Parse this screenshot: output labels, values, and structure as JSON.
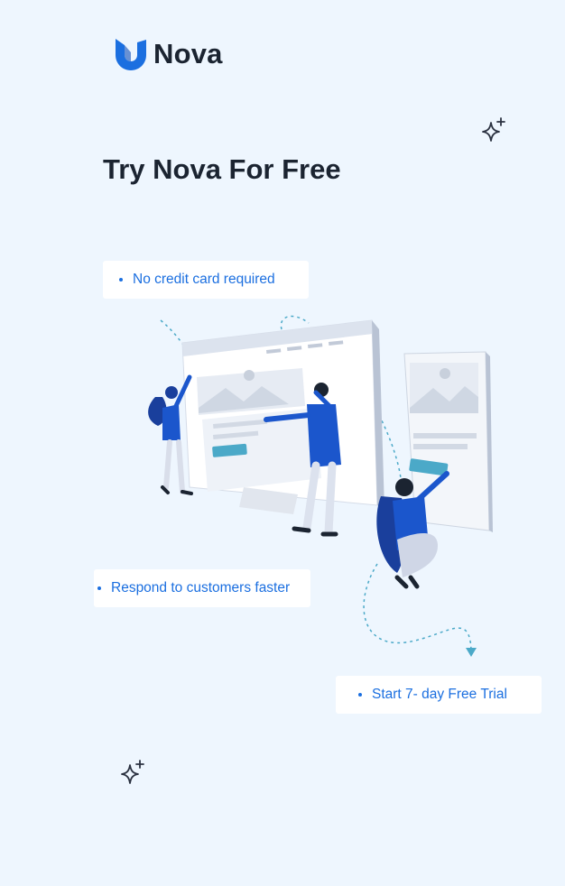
{
  "brand": {
    "name": "Nova",
    "color": "#1b6fe0"
  },
  "hero": {
    "title": "Try Nova For Free"
  },
  "features": [
    {
      "text": "No credit card required"
    },
    {
      "text": "Respond to customers faster"
    },
    {
      "text": "Start 7- day Free Trial"
    }
  ],
  "icons": {
    "sparkle": "sparkle-icon",
    "logo": "nova-logo-icon"
  },
  "colors": {
    "background": "#eef6fe",
    "text_dark": "#1b2431",
    "accent": "#1b6fe0",
    "accent_dark": "#1a3f9c",
    "teal": "#4ba9c8"
  }
}
